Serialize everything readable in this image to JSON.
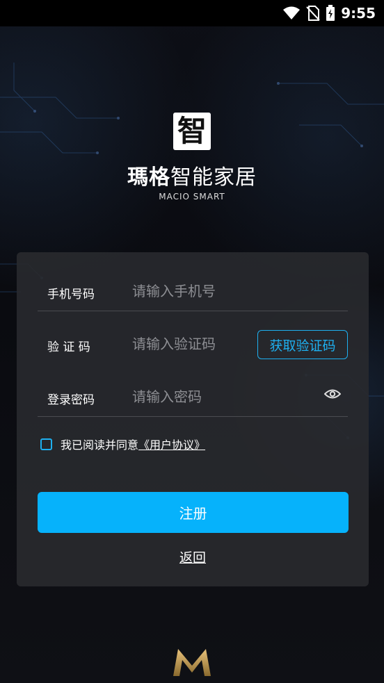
{
  "status": {
    "time": "9:55"
  },
  "brand": {
    "logo_char": "智",
    "name_bold": "瑪格",
    "name_rest": "智能家居",
    "subtitle": "MACIO SMART"
  },
  "form": {
    "phone": {
      "label": "手机号码",
      "placeholder": "请输入手机号",
      "value": ""
    },
    "code": {
      "label": "验 证 码",
      "placeholder": "请输入验证码",
      "value": "",
      "button": "获取验证码"
    },
    "password": {
      "label": "登录密码",
      "placeholder": "请输入密码",
      "value": ""
    }
  },
  "agreement": {
    "text": "我已阅读并同意",
    "link": "《用户协议》",
    "checked": false
  },
  "actions": {
    "register": "注册",
    "back": "返回"
  },
  "colors": {
    "accent": "#06b2fb",
    "card": "#28292e",
    "background": "#0b0c11"
  },
  "icons": [
    "wifi-icon",
    "no-sim-icon",
    "battery-charging-icon",
    "eye-icon",
    "brand-m-logo"
  ]
}
